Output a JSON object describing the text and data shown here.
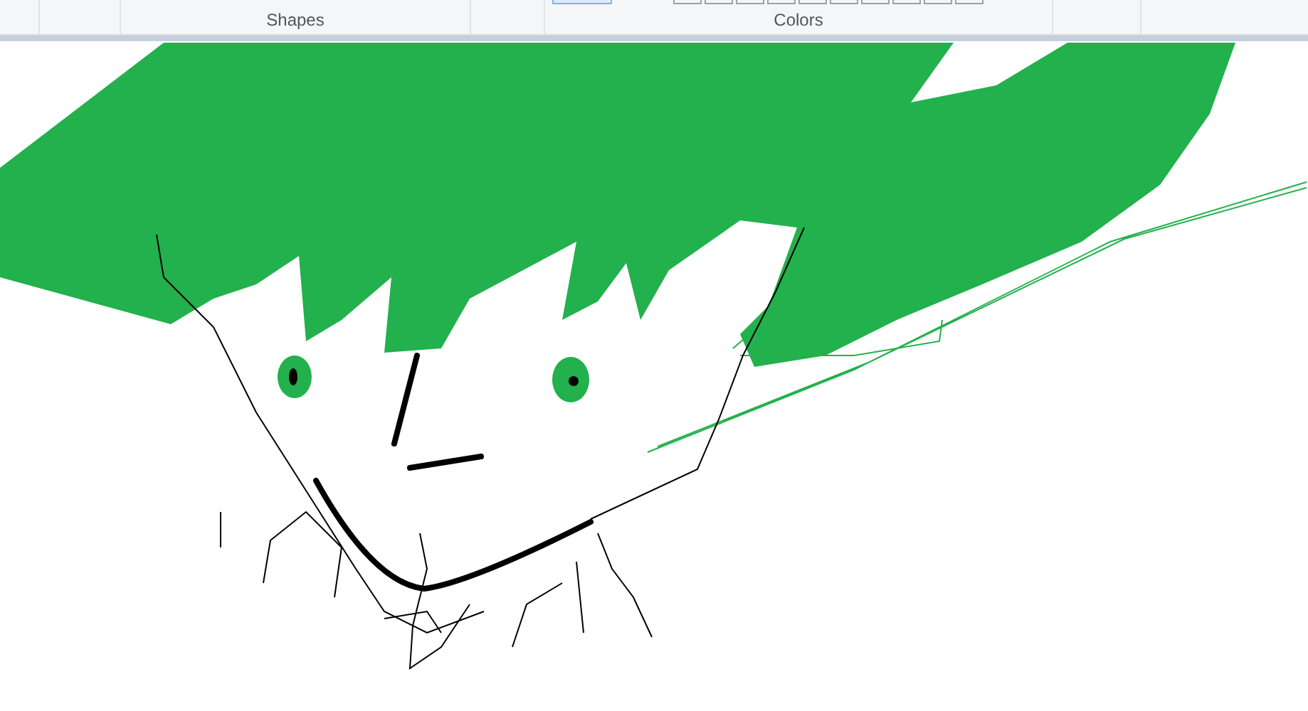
{
  "ribbon": {
    "groups": [
      {
        "label": "Shapes"
      },
      {
        "label": "Colors"
      }
    ]
  }
}
